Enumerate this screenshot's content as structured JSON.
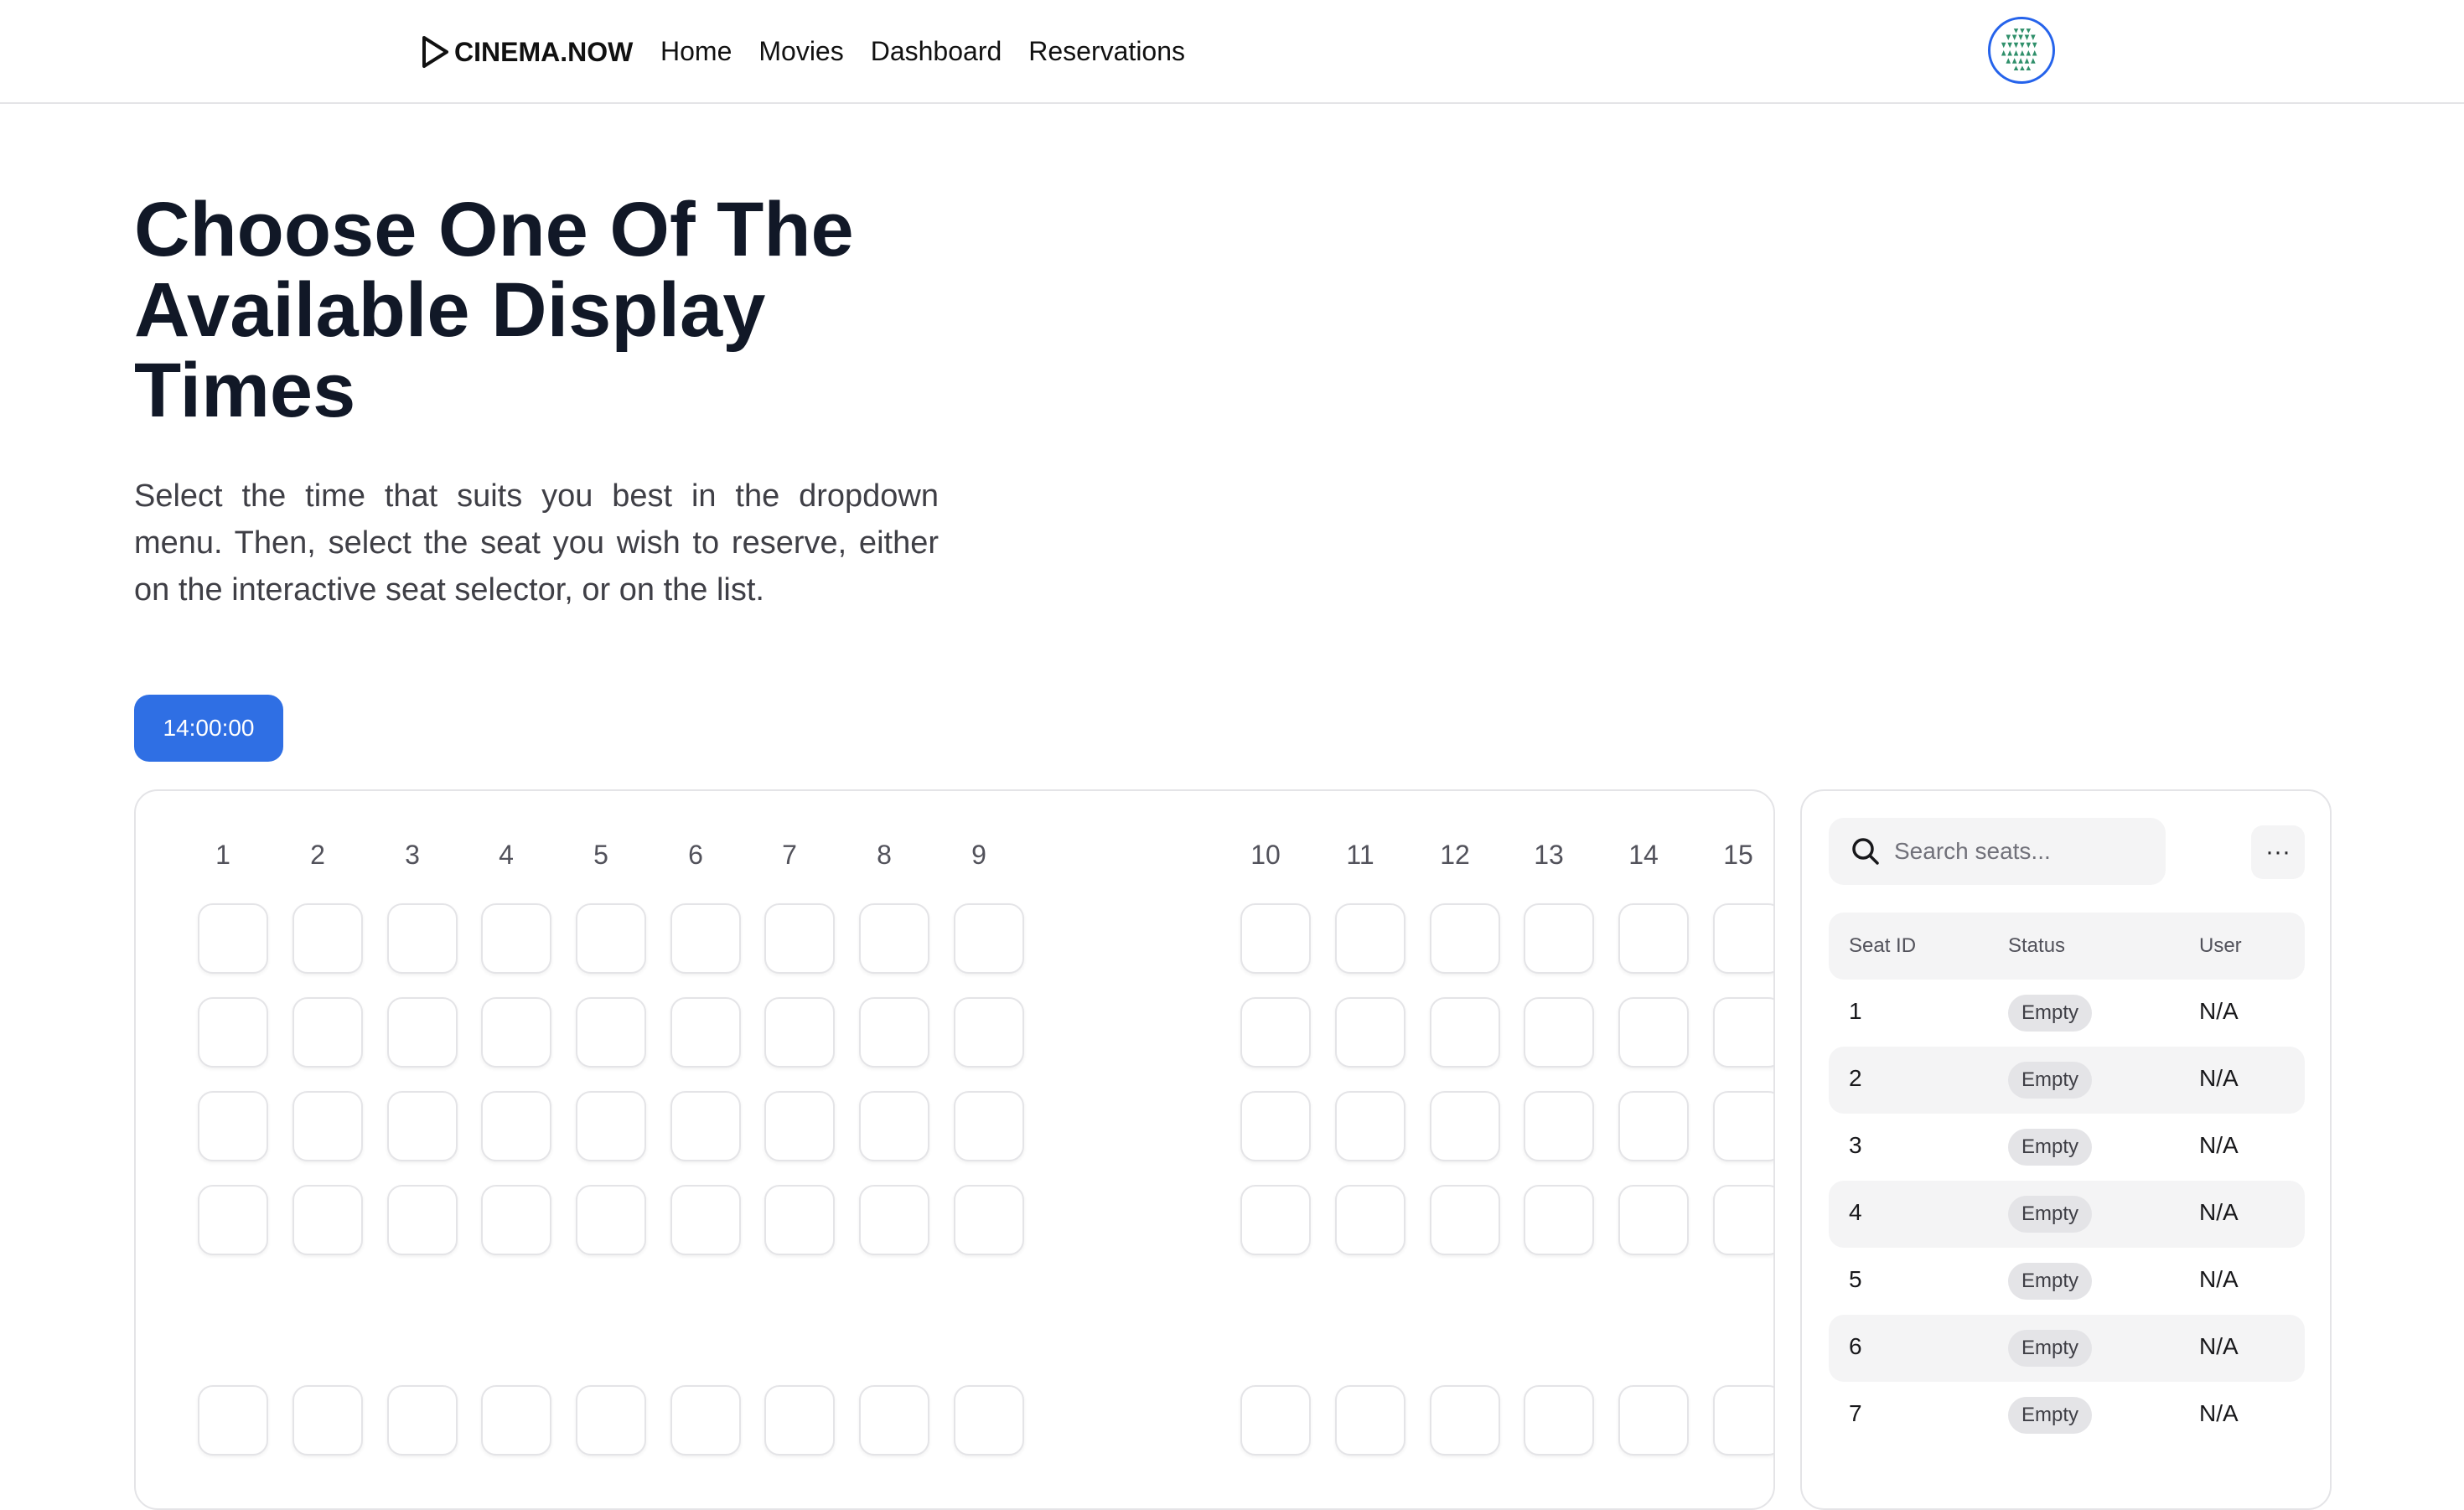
{
  "nav": {
    "brand": "CINEMA.NOW",
    "links": [
      "Home",
      "Movies",
      "Dashboard",
      "Reservations"
    ],
    "avatar_border_color": "#2563eb"
  },
  "hero": {
    "title": "Choose One Of The Available Display Times",
    "description": "Select the time that suits you best in the dropdown menu. Then, select the seat you wish to reserve, either on the interactive seat selector, or on the list."
  },
  "showtime": {
    "selected": "14:00:00",
    "accent_color": "#2f6fe4"
  },
  "seat_map": {
    "column_labels": [
      "1",
      "2",
      "3",
      "4",
      "5",
      "6",
      "7",
      "8",
      "9",
      "10",
      "11",
      "12",
      "13",
      "14",
      "15"
    ]
  },
  "seat_list": {
    "search_placeholder": "Search seats...",
    "more_label": "···",
    "headers": {
      "id": "Seat ID",
      "status": "Status",
      "user": "User"
    },
    "rows": [
      {
        "id": "1",
        "status": "Empty",
        "user": "N/A"
      },
      {
        "id": "2",
        "status": "Empty",
        "user": "N/A"
      },
      {
        "id": "3",
        "status": "Empty",
        "user": "N/A"
      },
      {
        "id": "4",
        "status": "Empty",
        "user": "N/A"
      },
      {
        "id": "5",
        "status": "Empty",
        "user": "N/A"
      },
      {
        "id": "6",
        "status": "Empty",
        "user": "N/A"
      },
      {
        "id": "7",
        "status": "Empty",
        "user": "N/A"
      }
    ]
  }
}
